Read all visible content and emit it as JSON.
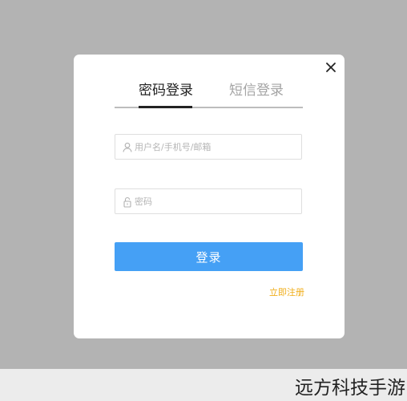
{
  "modal": {
    "tabs": [
      {
        "label": "密码登录",
        "active": true
      },
      {
        "label": "短信登录",
        "active": false
      }
    ],
    "username": {
      "placeholder": "用户名/手机号/邮箱",
      "value": ""
    },
    "password": {
      "placeholder": "密码",
      "value": ""
    },
    "login_label": "登录",
    "register_label": "立即注册"
  },
  "icons": {
    "close": "close-icon",
    "user": "user-icon",
    "lock": "lock-icon"
  },
  "colors": {
    "overlay": "#b3b3b3",
    "primary": "#45a0f5",
    "link": "#f0ad18",
    "active_tab": "#222222",
    "inactive_tab": "#a4a4a4"
  },
  "watermark": {
    "text": "远方科技手游"
  }
}
